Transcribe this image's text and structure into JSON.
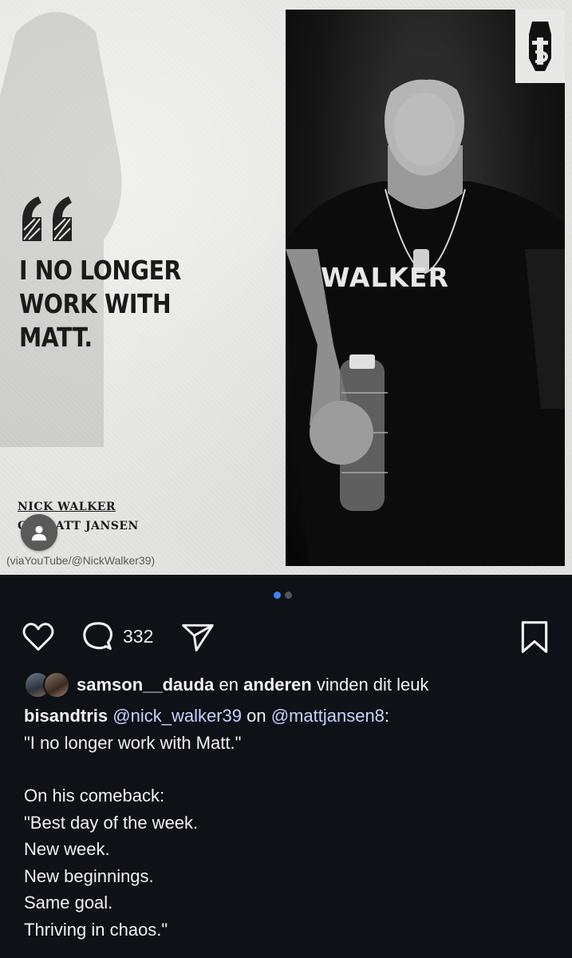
{
  "post": {
    "quote": "I NO LONGER WORK WITH MATT.",
    "byline_name": "NICK WALKER",
    "byline_sub_prefix": "C",
    "byline_sub": "ATT JANSEN",
    "source": "(viaYouTube/@NickWalker39)",
    "shirt_text": "WALKER",
    "pager": {
      "total": 2,
      "active": 1
    }
  },
  "actions": {
    "like_icon": "heart-icon",
    "comment_icon": "comment-icon",
    "comment_count": "332",
    "share_icon": "send-icon",
    "save_icon": "bookmark-icon"
  },
  "likes": {
    "user": "samson__dauda",
    "conj": "en",
    "others": "anderen",
    "suffix": "vinden dit leuk"
  },
  "caption": {
    "author": "bisandtris",
    "mention1": "@nick_walker39",
    "on": "on",
    "mention2": "@mattjansen8",
    "colon": ":",
    "line1": "\"I no longer work with Matt.\"",
    "line2": "On his comeback:",
    "line3": "\"Best day of the week.",
    "line4": "New week.",
    "line5": "New beginnings.",
    "line6": "Same goal.",
    "line7": "Thriving in chaos.\""
  },
  "colors": {
    "background": "#0e1116",
    "accent": "#3b82f6",
    "mention": "#c9d3ff"
  }
}
